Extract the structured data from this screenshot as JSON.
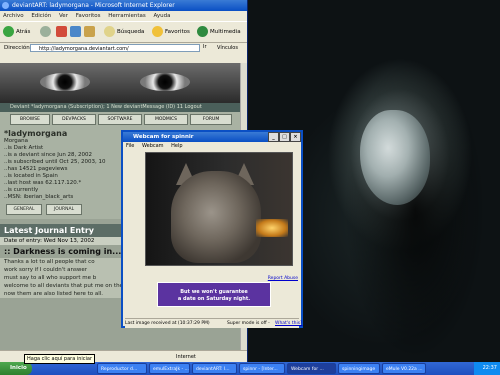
{
  "browser": {
    "title": "deviantART: ladymorgana - Microsoft Internet Explorer",
    "menu": [
      "Archivo",
      "Edición",
      "Ver",
      "Favoritos",
      "Herramientas",
      "Ayuda"
    ],
    "toolbar": {
      "back": "Atrás",
      "search": "Búsqueda",
      "favorites": "Favoritos",
      "multimedia": "Multimedia"
    },
    "address_label": "Dirección",
    "address_value": "http://ladymorgana.deviantart.com/",
    "go": "Ir",
    "links": "Vínculos",
    "status_text": "Internet"
  },
  "page": {
    "nav_line": "Deviant *ladymorgana (Subscription); 1 New deviantMessage (ID) 11 Logout",
    "tabs": [
      "BROWSE",
      "DEVPACKS",
      "SOFTWARE",
      "MODMICS",
      "FORUM"
    ],
    "profile": {
      "name": "*ladymorgana",
      "realname": "Morgana",
      "lines": [
        "..is Dark Artist",
        "..is a deviant since Jun 28, 2002",
        "..is subscribed until Oct 25, 2003, 10",
        "..has 14521 pageviews",
        "..is located in Spain",
        "..last host was 62.117.120.*",
        "..is currently",
        "..MSN: iberian_black_arts"
      ],
      "buttons": [
        "GENERAL",
        "JOURNAL"
      ]
    },
    "journal": {
      "heading": "Latest Journal Entry",
      "date": "Date of entry: Wed Nov 13, 2002",
      "title": ":: Darkness is coming in...",
      "body": [
        "Thanks a lot to all people that co",
        "work sorry if I couldn't answer",
        "must say to all who support me b",
        "welcome to all deviants that put me on their watch.",
        "now them are also listed here to all."
      ]
    }
  },
  "webcam": {
    "title": "Webcam for spinnir",
    "menu": [
      "File",
      "Webcam",
      "Help"
    ],
    "report": "Report Abuse",
    "ad_line1": "But we won't guarantee",
    "ad_line2": "a date on Saturday night.",
    "last_image": "Last image received at (10:37:29 PM)",
    "supervisor": "Super mode is off -",
    "whats_this": "What's this?"
  },
  "tooltip": "Haga clic aquí para iniciar",
  "taskbar": {
    "start": "Inicio",
    "tasks": [
      "Reproductor d...",
      "emulExtraJk - ...",
      "deviantART: l...",
      "spinnr - [Inter...",
      "Webcam for ...",
      "spinningimage",
      "eMule V0.22a ..."
    ],
    "clock": "22:37"
  }
}
